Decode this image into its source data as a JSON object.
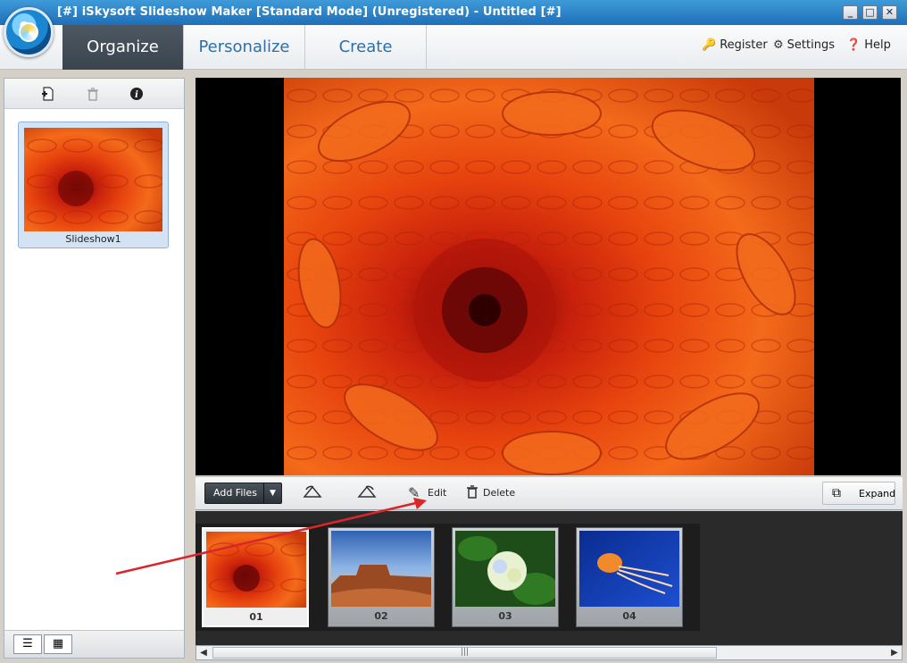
{
  "window": {
    "title": "[#] iSkysoft Slideshow Maker [Standard Mode] (Unregistered) - Untitled [#]",
    "controls": [
      "_",
      "□",
      "✕"
    ]
  },
  "nav": {
    "tabs": [
      {
        "label": "Organize",
        "active": true
      },
      {
        "label": "Personalize",
        "active": false
      },
      {
        "label": "Create",
        "active": false
      }
    ],
    "register_label": "Register",
    "settings_label": "Settings",
    "help_label": "Help"
  },
  "left_panel": {
    "toolbar_icons": [
      "add-file-icon",
      "trash-icon",
      "info-icon"
    ],
    "slideshow": {
      "label": "Slideshow1"
    }
  },
  "toolbar": {
    "add_files_label": "Add Files",
    "edit_label": "Edit",
    "delete_label": "Delete",
    "expand_label": "Expand"
  },
  "filmstrip": {
    "items": [
      {
        "num": "01",
        "selected": true
      },
      {
        "num": "02",
        "selected": false
      },
      {
        "num": "03",
        "selected": false
      },
      {
        "num": "04",
        "selected": false
      }
    ]
  },
  "colors": {
    "titlebar": "#1e6fb8",
    "tab_active": "#3a444d",
    "tab_text": "#2d6fa8",
    "annotation_arrow": "#d9262b"
  }
}
